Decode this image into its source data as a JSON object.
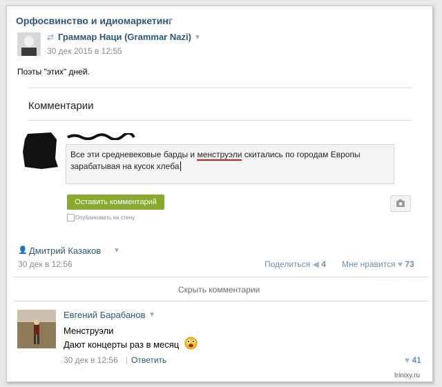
{
  "group": {
    "title": "Орфосвинство и идиомаркетинг"
  },
  "post": {
    "author": "Граммар Наци (Grammar Nazi)",
    "date": "30 дек 2015 в 12:55",
    "text": "Поэты \"этих\" дней."
  },
  "comments_section": {
    "heading": "Комментарии",
    "draft_text_part1": "Все эти средневековые барды и ",
    "draft_highlight": "менструэли",
    "draft_text_part2": " скитались по городам Европы",
    "draft_line2": "зарабатывая на кусок хлеба",
    "submit_label": "Оставить комментарий",
    "publish_label": "Опубликовать на стену"
  },
  "repost": {
    "user": "Дмитрий Казаков",
    "date": "30 дек в 12:56",
    "share_label": "Поделиться",
    "share_count": "4",
    "like_label": "Мне нравится",
    "like_count": "73"
  },
  "hide_comments_label": "Скрыть комментарии",
  "reply": {
    "user": "Евгений Барабанов",
    "line1": "Менструэли",
    "line2": "Дают концерты раз в месяц",
    "date": "30 дек в 12:56",
    "separator": "|",
    "reply_label": "Ответить",
    "like_count": "41"
  },
  "watermark": "trinixy.ru",
  "colors": {
    "link": "#2b587a",
    "button": "#8aa82f",
    "underline": "#d11a1a"
  }
}
